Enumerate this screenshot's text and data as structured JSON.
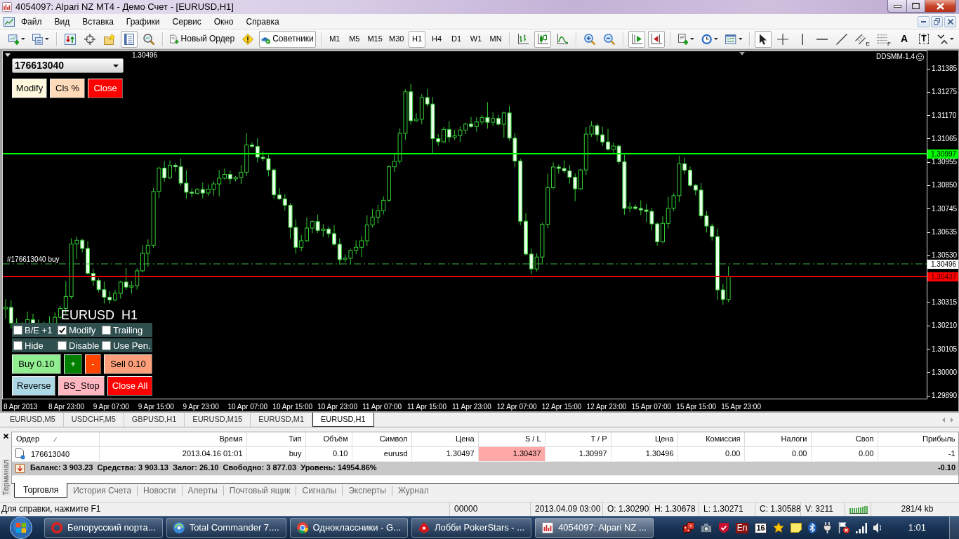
{
  "window": {
    "title": "4054097: Alpari NZ MT4 - Демо Счет - [EURUSD,H1]"
  },
  "menu": [
    "Файл",
    "Вид",
    "Вставка",
    "Графики",
    "Сервис",
    "Окно",
    "Справка"
  ],
  "toolbar": {
    "groups": [
      [
        {
          "kind": "new-chart",
          "selected": false
        },
        {
          "kind": "profiles",
          "selected": false
        }
      ],
      [
        {
          "kind": "market-watch",
          "selected": false
        },
        {
          "kind": "data-window",
          "selected": false
        },
        {
          "kind": "navigator",
          "selected": false
        },
        {
          "kind": "terminal",
          "selected": true
        },
        {
          "kind": "tester",
          "selected": false
        }
      ],
      [
        {
          "kind": "new-order",
          "label": "Новый Ордер",
          "selected": false
        },
        {
          "kind": "alert",
          "selected": false
        },
        {
          "kind": "experts",
          "label": "Советники",
          "selected": true
        }
      ],
      [
        {
          "kind": "timeframe",
          "label": "M1",
          "selected": false
        },
        {
          "kind": "timeframe",
          "label": "M5",
          "selected": false
        },
        {
          "kind": "timeframe",
          "label": "M15",
          "selected": false
        },
        {
          "kind": "timeframe",
          "label": "M30",
          "selected": false
        },
        {
          "kind": "timeframe",
          "label": "H1",
          "selected": true
        },
        {
          "kind": "timeframe",
          "label": "H4",
          "selected": false
        },
        {
          "kind": "timeframe",
          "label": "D1",
          "selected": false
        },
        {
          "kind": "timeframe",
          "label": "W1",
          "selected": false
        },
        {
          "kind": "timeframe",
          "label": "MN",
          "selected": false
        }
      ],
      [
        {
          "kind": "bar-chart",
          "selected": false
        },
        {
          "kind": "candles",
          "selected": true
        },
        {
          "kind": "line-chart",
          "selected": false
        }
      ],
      [
        {
          "kind": "zoom-in",
          "selected": false
        },
        {
          "kind": "zoom-out",
          "selected": false
        }
      ],
      [
        {
          "kind": "autoscroll",
          "selected": true
        },
        {
          "kind": "chart-shift",
          "selected": true
        }
      ],
      [
        {
          "kind": "indicators",
          "selected": false
        },
        {
          "kind": "periods",
          "selected": false
        },
        {
          "kind": "templates",
          "selected": false
        }
      ],
      [
        {
          "kind": "cursor",
          "selected": true
        },
        {
          "kind": "crosshair",
          "selected": false
        },
        {
          "kind": "vertical-line",
          "selected": false
        },
        {
          "kind": "horizontal-line",
          "selected": false
        },
        {
          "kind": "trend-line",
          "selected": false
        },
        {
          "kind": "channel",
          "label": "E",
          "selected": false
        },
        {
          "kind": "fibonacci",
          "label": "F",
          "selected": false
        },
        {
          "kind": "text",
          "label": "A",
          "selected": false
        },
        {
          "kind": "text-label",
          "label": "T",
          "selected": false
        },
        {
          "kind": "arrows",
          "selected": false
        }
      ]
    ]
  },
  "chart": {
    "header": "1.30496",
    "indicator": "DDSMM-1.4",
    "ticket": "176613040",
    "top_buttons": [
      {
        "label": "Modify",
        "color": "#fff8dc"
      },
      {
        "label": "Cls %",
        "color": "#ffdab9"
      },
      {
        "label": "Close",
        "color": "#ff0000"
      }
    ],
    "order_label": "#176613040 buy",
    "panel_title": "EURUSD  H1",
    "options": [
      {
        "label": "B/E +1",
        "checked": false
      },
      {
        "label": "Modify",
        "checked": true
      },
      {
        "label": "Trailing",
        "checked": false
      },
      {
        "label": "Hide",
        "checked": false
      },
      {
        "label": "Disable",
        "checked": false
      },
      {
        "label": "Use Pen.",
        "checked": false
      }
    ],
    "trade_buttons": [
      [
        {
          "label": "Buy 0.10",
          "color": "#90ee90"
        },
        {
          "label": "+",
          "color": "#008000"
        },
        {
          "label": "-",
          "color": "#ff4500"
        },
        {
          "label": "Sell 0.10",
          "color": "#ffa07a"
        }
      ],
      [
        {
          "label": "Reverse",
          "color": "#add8e6"
        },
        {
          "label": "BS_Stop",
          "color": "#ffb6c1"
        },
        {
          "label": "Close All",
          "color": "#ff0000"
        }
      ]
    ],
    "price_lines": [
      {
        "kind": "take_profit",
        "label": "1.30997"
      },
      {
        "kind": "open",
        "label": "1.30496"
      },
      {
        "kind": "stop_loss",
        "label": "1.30437"
      }
    ],
    "price_ticks": [
      "1.31385",
      "1.31275",
      "1.31170",
      "1.31065",
      "1.30955",
      "1.30850",
      "1.30745",
      "1.30635",
      "1.30530",
      "1.30315",
      "1.30210",
      "1.30105",
      "1.30000",
      "1.29890"
    ],
    "time_ticks": [
      "8 Apr 2013",
      "8 Apr 23:00",
      "9 Apr 07:00",
      "9 Apr 15:00",
      "9 Apr 23:00",
      "10 Apr 07:00",
      "10 Apr 15:00",
      "10 Apr 23:00",
      "11 Apr 07:00",
      "11 Apr 15:00",
      "11 Apr 23:00",
      "12 Apr 07:00",
      "12 Apr 15:00",
      "12 Apr 23:00",
      "15 Apr 07:00",
      "15 Apr 15:00",
      "15 Apr 23:00"
    ]
  },
  "chart_tabs": [
    {
      "label": "EURUSD,M5",
      "selected": false
    },
    {
      "label": "USDCHF,M5",
      "selected": false
    },
    {
      "label": "GBPUSD,H1",
      "selected": false
    },
    {
      "label": "EURUSD,M15",
      "selected": false
    },
    {
      "label": "EURUSD,M1",
      "selected": false
    },
    {
      "label": "EURUSD,H1",
      "selected": true
    }
  ],
  "terminal": {
    "title": "Терминал",
    "columns": [
      {
        "label": "Ордер",
        "sorted": true
      },
      {
        "label": "Время",
        "sorted": false
      },
      {
        "label": "Тип",
        "sorted": false
      },
      {
        "label": "Объём",
        "sorted": false
      },
      {
        "label": "Символ",
        "sorted": false
      },
      {
        "label": "Цена",
        "sorted": false
      },
      {
        "label": "S / L",
        "sorted": false
      },
      {
        "label": "T / P",
        "sorted": false
      },
      {
        "label": "Цена",
        "sorted": false
      },
      {
        "label": "Комиссия",
        "sorted": false
      },
      {
        "label": "Налоги",
        "sorted": false
      },
      {
        "label": "Своп",
        "sorted": false
      },
      {
        "label": "Прибыль",
        "sorted": false
      }
    ],
    "rows": [
      {
        "cells": [
          {
            "text": "176613040",
            "highlighted": false
          },
          {
            "text": "2013.04.16 01:01",
            "highlighted": false
          },
          {
            "text": "buy",
            "highlighted": false
          },
          {
            "text": "0.10",
            "highlighted": false
          },
          {
            "text": "eurusd",
            "highlighted": false
          },
          {
            "text": "1.30497",
            "highlighted": false
          },
          {
            "text": "1.30437",
            "highlighted": true
          },
          {
            "text": "1.30997",
            "highlighted": false
          },
          {
            "text": "1.30496",
            "highlighted": false
          },
          {
            "text": "0.00",
            "highlighted": false
          },
          {
            "text": "0.00",
            "highlighted": false
          },
          {
            "text": "0.00",
            "highlighted": false
          },
          {
            "text": "-1",
            "highlighted": false
          }
        ]
      }
    ],
    "summary": {
      "text": "Баланс: 3 903.23  Средства: 3 903.13  Залог: 26.10  Свободно: 3 877.03  Уровень: 14954.86%",
      "profit": "-0.10"
    },
    "tabs": [
      {
        "label": "Торговля",
        "selected": true
      },
      {
        "label": "История Счета",
        "selected": false
      },
      {
        "label": "Новости",
        "selected": false
      },
      {
        "label": "Алерты",
        "selected": false
      },
      {
        "label": "Почтовый ящик",
        "selected": false
      },
      {
        "label": "Сигналы",
        "selected": false
      },
      {
        "label": "Эксперты",
        "selected": false
      },
      {
        "label": "Журнал",
        "selected": false
      }
    ]
  },
  "status_bar": {
    "help": "Для справки, нажмите F1",
    "fields": [
      "00000",
      "2013.04.09 03:00",
      "O: 1.30290",
      "H: 1.30678",
      "L: 1.30271",
      "C: 1.30588",
      "V: 3211"
    ],
    "traffic": "281/4 kb"
  },
  "taskbar": {
    "buttons": [
      {
        "kind": "ring",
        "label": "Белорусский порта...",
        "selected": false
      },
      {
        "kind": "disc",
        "label": "Total Commander 7....",
        "selected": false
      },
      {
        "kind": "segmented",
        "label": "Одноклассники - G...",
        "selected": false
      },
      {
        "kind": "spade",
        "label": "Лобби PokerStars - ...",
        "selected": false
      },
      {
        "kind": "chart",
        "label": "4054097: Alpari NZ ...",
        "selected": true
      }
    ],
    "tray": [
      {
        "kind": "dice"
      },
      {
        "kind": "camera"
      },
      {
        "kind": "shield"
      },
      {
        "kind": "language",
        "label": "En"
      },
      {
        "kind": "calendar",
        "label": "16"
      },
      {
        "kind": "star"
      },
      {
        "kind": "note"
      },
      {
        "kind": "bluetooth"
      },
      {
        "kind": "plug"
      },
      {
        "kind": "flag"
      },
      {
        "kind": "signal"
      },
      {
        "kind": "speaker"
      }
    ],
    "clock": "1:01"
  }
}
